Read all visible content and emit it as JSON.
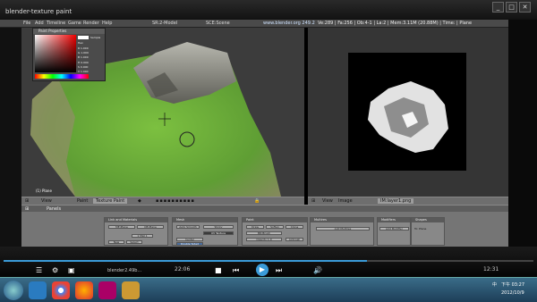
{
  "window": {
    "title": "blender-texture paint"
  },
  "menu": {
    "items": [
      "File",
      "Add",
      "Timeline",
      "Game",
      "Render",
      "Help"
    ],
    "screen": "SR:2-Model",
    "scene": "SCE:Scene",
    "url": "www.blender.org 249.2",
    "stats": "Ve:289 | Fa:256 | Ob:4-1 | La:2 | Mem:3.11M (20.88M) | Time: | Plane"
  },
  "paint_props": {
    "title": "Paint Properties",
    "sample_label": "Sample",
    "hex_label": "Hex",
    "r": "R 1.000",
    "g": "G 1.000",
    "b": "B 1.000",
    "h": "H 0.000",
    "s": "S 0.000",
    "v": "V 1.000"
  },
  "viewport": {
    "object_label": "(1) Plane",
    "view_menu": "View",
    "mode": "Texture Paint"
  },
  "image_editor": {
    "view_menu": "View",
    "image_menu": "Image",
    "image_name": "IM:layer1.png"
  },
  "buttons": {
    "view_menu": "Panels",
    "panels": [
      {
        "title": "Link and Materials"
      },
      {
        "title": "Mesh"
      },
      {
        "title": "Paint"
      },
      {
        "title": "Multires"
      },
      {
        "title": "Modifiers"
      },
      {
        "title": "Shapes"
      }
    ],
    "add_multires": "Add Multires",
    "add_modifier": "Add Modifier",
    "to_plane": "To: Plane"
  },
  "media": {
    "title": "blender2.49b...",
    "time_left": "22:06",
    "time_right": "12:31"
  },
  "tray": {
    "lang": "中",
    "time": "下午 03:27",
    "date": "2012/10/9"
  },
  "colors": {
    "terrain": "#6fae3a",
    "rock": "#8a8a82",
    "accent": "#3b9bd8"
  }
}
